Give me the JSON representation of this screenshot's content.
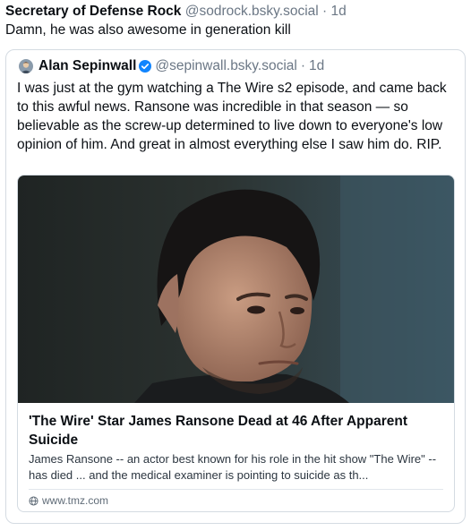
{
  "post": {
    "author_name": "Secretary of Defense Rock",
    "handle": "@sodrock.bsky.social",
    "separator": "·",
    "time": "1d",
    "text": "Damn, he was also awesome in generation kill"
  },
  "quote": {
    "author_name": "Alan Sepinwall",
    "handle": "@sepinwall.bsky.social",
    "separator": "·",
    "time": "1d",
    "text": "I was just at the gym watching a The Wire s2 episode, and came back to this awful news. Ransone was incredible in that season — so believable as the screw-up determined to live down to everyone's low opinion of him. And great in almost everything else I saw him do. RIP.",
    "verified_icon": "verified-check-icon"
  },
  "link_card": {
    "title": "'The Wire' Star James Ransone Dead at 46 After Apparent Suicide",
    "description": "James Ransone -- an actor best known for his role in the hit show \"The Wire\" -- has died ... and the medical examiner is pointing to suicide as th...",
    "source": "www.tmz.com",
    "source_icon": "globe-icon"
  },
  "colors": {
    "text": "#0b0f14",
    "muted": "#6b7785",
    "border": "#d4dbe2",
    "verified": "#1185fe"
  }
}
